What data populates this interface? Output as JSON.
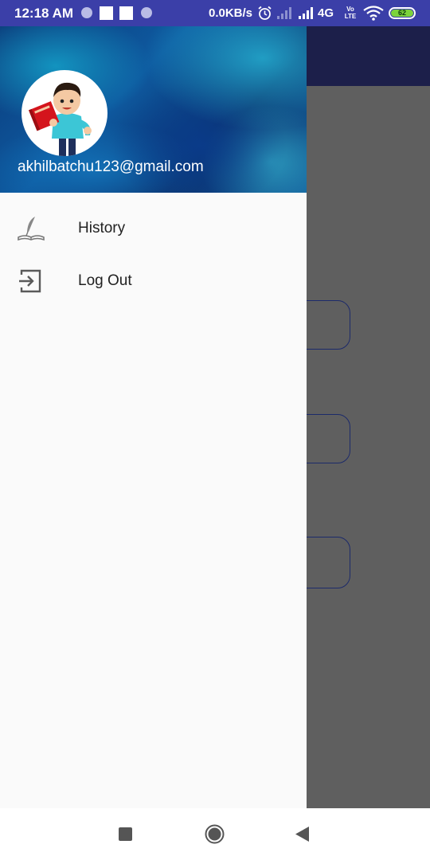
{
  "status_bar": {
    "time": "12:18 AM",
    "net_speed": "0.0KB/s",
    "network": "4G",
    "volte": "Vo LTE",
    "battery_percent": "62",
    "icons": [
      "notification-dot-icon",
      "square-notification-icon",
      "square-notification-icon",
      "notification-dot-icon",
      "alarm-icon",
      "signal-weak-icon",
      "signal-icon",
      "volte-icon",
      "wifi-icon",
      "battery-icon"
    ]
  },
  "drawer": {
    "header": {
      "email": "akhilbatchu123@gmail.com",
      "avatar_icon": "boy-with-book-avatar"
    },
    "menu": [
      {
        "label": "History",
        "icon": "quill-book-icon"
      },
      {
        "label": "Log Out",
        "icon": "logout-icon"
      }
    ]
  },
  "nav_bar": {
    "buttons": [
      "recents-square-icon",
      "home-circle-icon",
      "back-triangle-icon"
    ]
  },
  "colors": {
    "status_bar": "#3b3fa8",
    "toolbar": "#1c1f4a",
    "scrim": "#5f5f5f",
    "drawer_bg": "#fafafa",
    "battery": "#7cd33c"
  }
}
